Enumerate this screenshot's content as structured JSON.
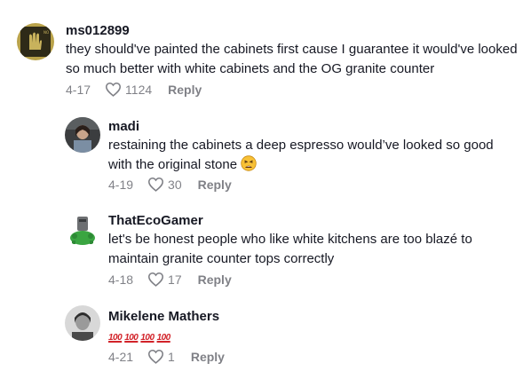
{
  "comments": [
    {
      "username": "ms012899",
      "text": "they should've painted the cabinets first cause I guarantee it would've looked so much better with white cabinets and the OG granite counter",
      "date": "4-17",
      "likes": "1124",
      "reply": "Reply"
    },
    {
      "username": "madi",
      "text": "restaining the cabinets a deep espresso would’ve looked so good with the original stone",
      "emoji": "tired-face-emoji",
      "date": "4-19",
      "likes": "30",
      "reply": "Reply"
    },
    {
      "username": "ThatEcoGamer",
      "text": "let's be honest people who like white kitchens are too blazé to maintain granite counter tops correctly",
      "date": "4-18",
      "likes": "17",
      "reply": "Reply"
    },
    {
      "username": "Mikelene Mathers",
      "emojis": [
        "100",
        "100",
        "100",
        "100"
      ],
      "date": "4-21",
      "likes": "1",
      "reply": "Reply"
    }
  ],
  "colors": {
    "text": "#161823",
    "muted": "rgba(22,24,35,0.55)",
    "hundred_red": "#d2232a"
  }
}
